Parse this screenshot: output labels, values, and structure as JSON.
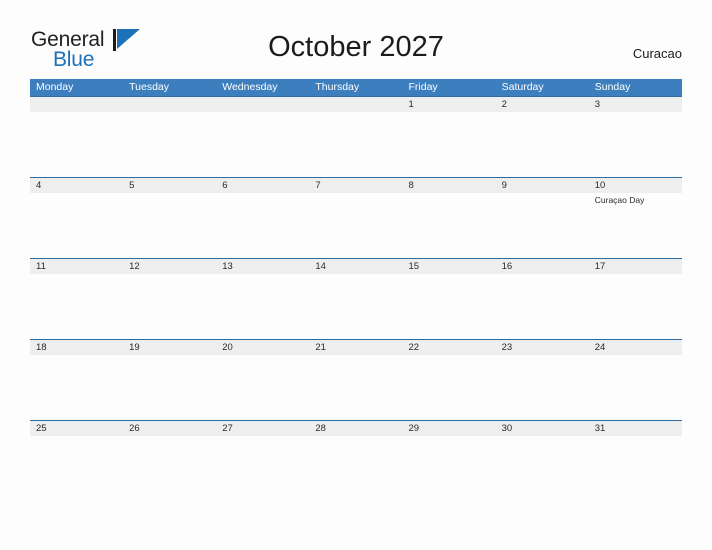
{
  "brand": {
    "name_part1": "General",
    "name_part2": "Blue",
    "mark": "blue-triangle-flag",
    "accent_color": "#1d71b8"
  },
  "header": {
    "title": "October 2027",
    "country": "Curacao"
  },
  "colors": {
    "header_blue": "#3d7ebf",
    "row_rule_blue": "#2e6da4",
    "date_strip_gray": "#eeeeee",
    "page_background": "#fdfdfd",
    "text": "#2a2a2a"
  },
  "calendar": {
    "weekdays": [
      "Monday",
      "Tuesday",
      "Wednesday",
      "Thursday",
      "Friday",
      "Saturday",
      "Sunday"
    ],
    "weeks": [
      {
        "days": [
          {
            "date": "",
            "events": []
          },
          {
            "date": "",
            "events": []
          },
          {
            "date": "",
            "events": []
          },
          {
            "date": "",
            "events": []
          },
          {
            "date": "1",
            "events": []
          },
          {
            "date": "2",
            "events": []
          },
          {
            "date": "3",
            "events": []
          }
        ]
      },
      {
        "days": [
          {
            "date": "4",
            "events": []
          },
          {
            "date": "5",
            "events": []
          },
          {
            "date": "6",
            "events": []
          },
          {
            "date": "7",
            "events": []
          },
          {
            "date": "8",
            "events": []
          },
          {
            "date": "9",
            "events": []
          },
          {
            "date": "10",
            "events": [
              "Curaçao Day"
            ]
          }
        ]
      },
      {
        "days": [
          {
            "date": "11",
            "events": []
          },
          {
            "date": "12",
            "events": []
          },
          {
            "date": "13",
            "events": []
          },
          {
            "date": "14",
            "events": []
          },
          {
            "date": "15",
            "events": []
          },
          {
            "date": "16",
            "events": []
          },
          {
            "date": "17",
            "events": []
          }
        ]
      },
      {
        "days": [
          {
            "date": "18",
            "events": []
          },
          {
            "date": "19",
            "events": []
          },
          {
            "date": "20",
            "events": []
          },
          {
            "date": "21",
            "events": []
          },
          {
            "date": "22",
            "events": []
          },
          {
            "date": "23",
            "events": []
          },
          {
            "date": "24",
            "events": []
          }
        ]
      },
      {
        "days": [
          {
            "date": "25",
            "events": []
          },
          {
            "date": "26",
            "events": []
          },
          {
            "date": "27",
            "events": []
          },
          {
            "date": "28",
            "events": []
          },
          {
            "date": "29",
            "events": []
          },
          {
            "date": "30",
            "events": []
          },
          {
            "date": "31",
            "events": []
          }
        ]
      }
    ]
  }
}
